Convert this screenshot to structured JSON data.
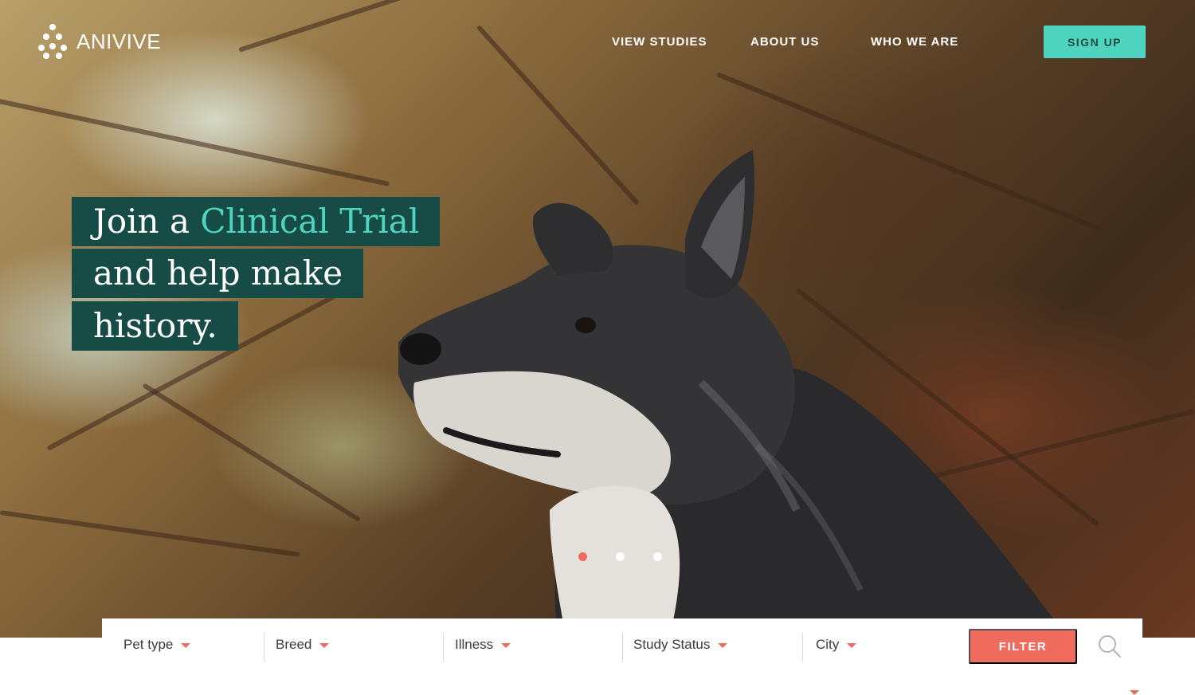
{
  "brand": {
    "name": "ANIVIVE"
  },
  "nav": {
    "items": [
      {
        "label": "VIEW STUDIES"
      },
      {
        "label": "ABOUT US"
      },
      {
        "label": "WHO WE ARE"
      }
    ],
    "signup_label": "SIGN UP"
  },
  "hero": {
    "headline_line1_plain": "Join a ",
    "headline_line1_accent": "Clinical Trial",
    "headline_line2": "and help make",
    "headline_line3": "history.",
    "carousel": {
      "slides": 3,
      "active": 1
    }
  },
  "filters": {
    "items": [
      {
        "label": "Pet type"
      },
      {
        "label": "Breed"
      },
      {
        "label": "Illness"
      },
      {
        "label": "Study Status"
      },
      {
        "label": "City"
      }
    ],
    "filter_button": "FILTER"
  },
  "colors": {
    "accent_teal": "#4fd4bf",
    "headline_bg": "#174b46",
    "coral": "#ef6b5c"
  }
}
